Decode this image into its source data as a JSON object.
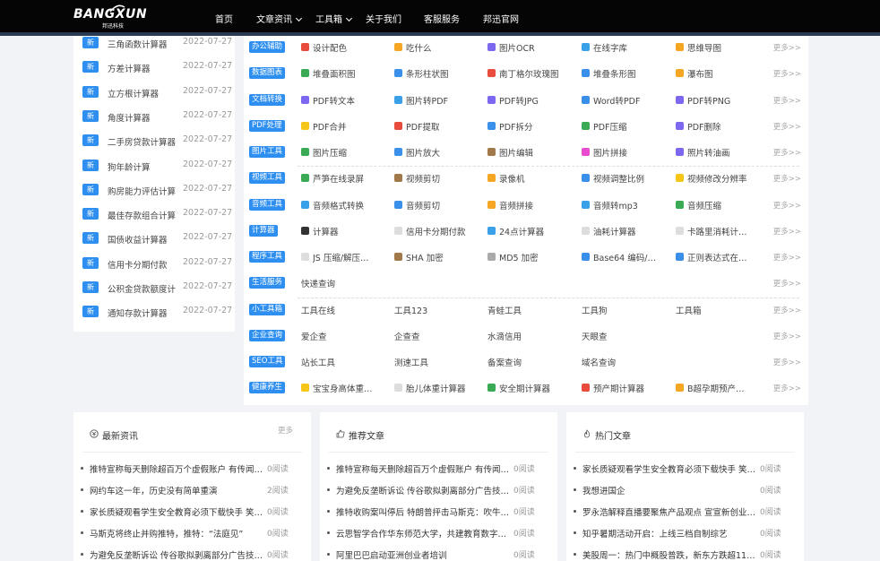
{
  "brand": {
    "logo_text": "BANGXUN",
    "logo_sub": "邦迅科技"
  },
  "nav": [
    {
      "label": "首页",
      "dropdown": false
    },
    {
      "label": "文章资讯",
      "dropdown": true
    },
    {
      "label": "工具箱",
      "dropdown": true
    },
    {
      "label": "关于我们",
      "dropdown": false
    },
    {
      "label": "客服服务",
      "dropdown": false
    },
    {
      "label": "邦迅官网",
      "dropdown": false
    }
  ],
  "new_tools": {
    "badge": "新",
    "items": [
      {
        "name": "三角函数计算器",
        "date": "2022-07-27"
      },
      {
        "name": "方差计算器",
        "date": "2022-07-27"
      },
      {
        "name": "立方根计算器",
        "date": "2022-07-27"
      },
      {
        "name": "角度计算器",
        "date": "2022-07-27"
      },
      {
        "name": "二手房贷款计算器",
        "date": "2022-07-27"
      },
      {
        "name": "狗年龄计算",
        "date": "2022-07-27"
      },
      {
        "name": "购房能力评估计算",
        "date": "2022-07-27"
      },
      {
        "name": "最佳存款组合计算",
        "date": "2022-07-27"
      },
      {
        "name": "国债收益计算器",
        "date": "2022-07-27"
      },
      {
        "name": "信用卡分期付款",
        "date": "2022-07-27"
      },
      {
        "name": "公积金贷款额度计",
        "date": "2022-07-27"
      },
      {
        "name": "通知存款计算器",
        "date": "2022-07-27"
      }
    ]
  },
  "tool_more": "更多>>",
  "tool_rows": [
    {
      "category": "办公辅助",
      "tools": [
        {
          "name": "设计配色",
          "icon": "palette-icon",
          "color": "#e94b3c"
        },
        {
          "name": "吃什么",
          "icon": "food-icon",
          "color": "#f5a623"
        },
        {
          "name": "图片OCR",
          "icon": "ocr-icon",
          "color": "#7b68ee"
        },
        {
          "name": "在线字库",
          "icon": "font-icon",
          "color": "#3aa0e8"
        },
        {
          "name": "思维导图",
          "icon": "mindmap-icon",
          "color": "#f5a623"
        }
      ]
    },
    {
      "category": "数据图表",
      "tools": [
        {
          "name": "堆叠面积图",
          "icon": "area-chart-icon",
          "color": "#3aaa55"
        },
        {
          "name": "条形柱状图",
          "icon": "bar-chart-icon",
          "color": "#3a8fe8"
        },
        {
          "name": "南丁格尔玫瑰图",
          "icon": "rose-chart-icon",
          "color": "#e94b3c"
        },
        {
          "name": "堆叠条形图",
          "icon": "stacked-bar-icon",
          "color": "#3a8fe8"
        },
        {
          "name": "瀑布图",
          "icon": "waterfall-icon",
          "color": "#f5a623"
        }
      ]
    },
    {
      "category": "文档转换",
      "tools": [
        {
          "name": "PDF转文本",
          "icon": "pdf-text-icon",
          "color": "#7b68ee"
        },
        {
          "name": "图片转PDF",
          "icon": "image-pdf-icon",
          "color": "#3aa0e8"
        },
        {
          "name": "PDF转JPG",
          "icon": "pdf-jpg-icon",
          "color": "#7b68ee"
        },
        {
          "name": "Word转PDF",
          "icon": "word-pdf-icon",
          "color": "#3a8fe8"
        },
        {
          "name": "PDF转PNG",
          "icon": "pdf-png-icon",
          "color": "#7b68ee"
        }
      ]
    },
    {
      "category": "PDF处理",
      "tools": [
        {
          "name": "PDF合并",
          "icon": "pdf-merge-icon",
          "color": "#f5c518"
        },
        {
          "name": "PDF提取",
          "icon": "pdf-extract-icon",
          "color": "#e94b3c"
        },
        {
          "name": "PDF拆分",
          "icon": "pdf-split-icon",
          "color": "#3a8fe8"
        },
        {
          "name": "PDF压缩",
          "icon": "pdf-compress-icon",
          "color": "#3aaa55"
        },
        {
          "name": "PDF删除",
          "icon": "pdf-delete-icon",
          "color": "#7b68ee"
        }
      ]
    },
    {
      "category": "图片工具",
      "tools": [
        {
          "name": "图片压缩",
          "icon": "image-compress-icon",
          "color": "#3aaa55"
        },
        {
          "name": "图片放大",
          "icon": "image-enlarge-icon",
          "color": "#3a8fe8"
        },
        {
          "name": "图片编辑",
          "icon": "image-edit-icon",
          "color": "#a0784a"
        },
        {
          "name": "图片拼接",
          "icon": "image-stitch-icon",
          "color": "#e94bd0"
        },
        {
          "name": "照片转油画",
          "icon": "oil-painting-icon",
          "color": "#7b68ee"
        }
      ]
    },
    {
      "category": "视频工具",
      "tools": [
        {
          "name": "芦笋在线录屏",
          "icon": "screen-record-icon",
          "color": "#3aaa55"
        },
        {
          "name": "视频剪切",
          "icon": "video-cut-icon",
          "color": "#a0784a"
        },
        {
          "name": "录像机",
          "icon": "camcorder-icon",
          "color": "#f5a623"
        },
        {
          "name": "视频调整比例",
          "icon": "video-ratio-icon",
          "color": "#3a8fe8"
        },
        {
          "name": "视频修改分辨率",
          "icon": "video-resolution-icon",
          "color": "#f5c518"
        }
      ]
    },
    {
      "category": "音频工具",
      "tools": [
        {
          "name": "音频格式转换",
          "icon": "audio-convert-icon",
          "color": "#3aa0e8"
        },
        {
          "name": "音频剪切",
          "icon": "audio-cut-icon",
          "color": "#3a8fe8"
        },
        {
          "name": "音频拼接",
          "icon": "audio-join-icon",
          "color": "#f5a623"
        },
        {
          "name": "音频转mp3",
          "icon": "audio-mp3-icon",
          "color": "#3aa0e8"
        },
        {
          "name": "音频压缩",
          "icon": "headphones-icon",
          "color": "#3aaa55"
        }
      ]
    },
    {
      "category": "计算器",
      "tools": [
        {
          "name": "计算器",
          "icon": "calculator-icon",
          "color": "#333333"
        },
        {
          "name": "信用卡分期付款",
          "icon": "credit-card-icon",
          "color": "#dddddd"
        },
        {
          "name": "24点计算器",
          "icon": "24-point-icon",
          "color": "#3aa0e8"
        },
        {
          "name": "油耗计算器",
          "icon": "fuel-icon",
          "color": "#dddddd"
        },
        {
          "name": "卡路里消耗计…",
          "icon": "calorie-icon",
          "color": "#dddddd"
        }
      ]
    },
    {
      "category": "程序工具",
      "tools": [
        {
          "name": "JS 压缩/解压…",
          "icon": "js-compress-icon",
          "color": "#dddddd"
        },
        {
          "name": "SHA 加密",
          "icon": "sha-icon",
          "color": "#a0784a"
        },
        {
          "name": "MD5 加密",
          "icon": "md5-icon",
          "color": "#aaaaaa"
        },
        {
          "name": "Base64 编码/…",
          "icon": "base64-icon",
          "color": "#3a8fe8"
        },
        {
          "name": "正则表达式在…",
          "icon": "regex-icon",
          "color": "#3a8fe8"
        }
      ]
    },
    {
      "category": "生活服务",
      "tools": [
        {
          "name": "快递查询",
          "icon": "",
          "color": ""
        }
      ]
    },
    {
      "category": "小工具箱",
      "tools": [
        {
          "name": "工具在线",
          "icon": "",
          "color": ""
        },
        {
          "name": "工具123",
          "icon": "",
          "color": ""
        },
        {
          "name": "青蛙工具",
          "icon": "",
          "color": ""
        },
        {
          "name": "工具狗",
          "icon": "",
          "color": ""
        },
        {
          "name": "工具箱",
          "icon": "",
          "color": ""
        }
      ]
    },
    {
      "category": "企业查询",
      "tools": [
        {
          "name": "爱企查",
          "icon": "",
          "color": ""
        },
        {
          "name": "企查查",
          "icon": "",
          "color": ""
        },
        {
          "name": "水滴信用",
          "icon": "",
          "color": ""
        },
        {
          "name": "天眼查",
          "icon": "",
          "color": ""
        }
      ]
    },
    {
      "category": "SEO工具",
      "tools": [
        {
          "name": "站长工具",
          "icon": "",
          "color": ""
        },
        {
          "name": "测速工具",
          "icon": "",
          "color": ""
        },
        {
          "name": "备案查询",
          "icon": "",
          "color": ""
        },
        {
          "name": "域名查询",
          "icon": "",
          "color": ""
        }
      ]
    },
    {
      "category": "健康养生",
      "tools": [
        {
          "name": "宝宝身高体重…",
          "icon": "baby-height-icon",
          "color": "#f5c518"
        },
        {
          "name": "胎儿体重计算器",
          "icon": "fetus-weight-icon",
          "color": "#dddddd"
        },
        {
          "name": "安全期计算器",
          "icon": "safe-period-icon",
          "color": "#3aaa55"
        },
        {
          "name": "预产期计算器",
          "icon": "due-date-icon",
          "color": "#e94b3c"
        },
        {
          "name": "B超孕期预产…",
          "icon": "ultrasound-icon",
          "color": "#f5a623"
        }
      ]
    }
  ],
  "panels": [
    {
      "title": "最新资讯",
      "icon": "money-icon",
      "more": "更多",
      "items": [
        {
          "title": "推特宣称每天删除超百万个虚假账户 有传闻…",
          "reads": "0阅读"
        },
        {
          "title": "网约车这一年，历史没有简单重演",
          "reads": "2阅读"
        },
        {
          "title": "家长质疑观看学生安全教育必须下载快手 笑…",
          "reads": "0阅读"
        },
        {
          "title": "马斯克将终止并购推特，推特：“法庭见”",
          "reads": "0阅读"
        },
        {
          "title": "为避免反垄断诉讼 传谷歌拟剥离部分广告技…",
          "reads": "0阅读"
        }
      ]
    },
    {
      "title": "推荐文章",
      "icon": "thumbs-up-icon",
      "more": "",
      "items": [
        {
          "title": "推特宣称每天删除超百万个虚假账户 有传闻…",
          "reads": "0阅读"
        },
        {
          "title": "为避免反垄断诉讼 传谷歌拟剥离部分广告技…",
          "reads": "0阅读"
        },
        {
          "title": "推特收购案叫停后 特朗普抨击马斯克：吹牛…",
          "reads": "0阅读"
        },
        {
          "title": "云思智学合作华东师范大学，共建教育数字…",
          "reads": "0阅读"
        },
        {
          "title": "阿里巴巴启动亚洲创业者培训",
          "reads": "0阅读"
        }
      ]
    },
    {
      "title": "热门文章",
      "icon": "flame-icon",
      "more": "",
      "items": [
        {
          "title": "家长质疑观看学生安全教育必须下载快手 笑…",
          "reads": "0阅读"
        },
        {
          "title": "我想进国企",
          "reads": "0阅读"
        },
        {
          "title": "罗永浩解释直播要聚焦产品观点 宣宣新创业…",
          "reads": "0阅读"
        },
        {
          "title": "知乎暑期活动开启：上线三档自制综艺",
          "reads": "0阅读"
        },
        {
          "title": "美股周一：热门中概股普跌，新东方跌超11…",
          "reads": "0阅读"
        }
      ]
    }
  ]
}
